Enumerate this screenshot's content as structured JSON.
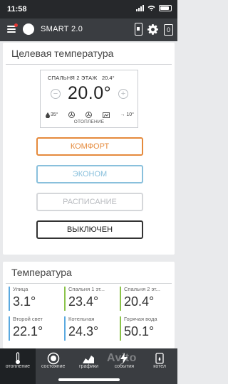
{
  "status_bar": {
    "time": "11:58"
  },
  "app_bar": {
    "title": "SMART 2.0",
    "badge": "0"
  },
  "target_card": {
    "title": "Целевая температура",
    "room_name": "СПАЛЬНЯ 2 ЭТАЖ",
    "room_temp": "20.4°",
    "minus": "−",
    "plus": "+",
    "setpoint": "20.0°",
    "water_temp": "35°",
    "outdoor_temp": "→ 10°",
    "mode_label": "ОТОПЛЕНИЕ",
    "buttons": {
      "comfort": "КОМФОРТ",
      "econom": "ЭКОНОМ",
      "schedule": "РАСПИСАНИЕ",
      "off": "ВЫКЛЮЧЕН"
    }
  },
  "temps_card": {
    "title": "Температура",
    "items": [
      {
        "label": "Улица",
        "value": "3.1°",
        "color": "#5aa9e0"
      },
      {
        "label": "Спальня 1 эт...",
        "value": "23.4°",
        "color": "#8bc34a"
      },
      {
        "label": "Спальня 2 эт...",
        "value": "20.4°",
        "color": "#8bc34a"
      },
      {
        "label": "Второй свет",
        "value": "22.1°",
        "color": "#5aa9e0"
      },
      {
        "label": "Котельная",
        "value": "24.3°",
        "color": "#5aa9e0"
      },
      {
        "label": "Горячая вода",
        "value": "50.1°",
        "color": "#8bc34a"
      }
    ]
  },
  "tabs": [
    {
      "label": "отопление",
      "icon": "thermometer-icon"
    },
    {
      "label": "состояние",
      "icon": "status-icon"
    },
    {
      "label": "графики",
      "icon": "chart-icon"
    },
    {
      "label": "события",
      "icon": "events-icon"
    },
    {
      "label": "котел",
      "icon": "boiler-icon"
    }
  ],
  "watermark": "Avito"
}
